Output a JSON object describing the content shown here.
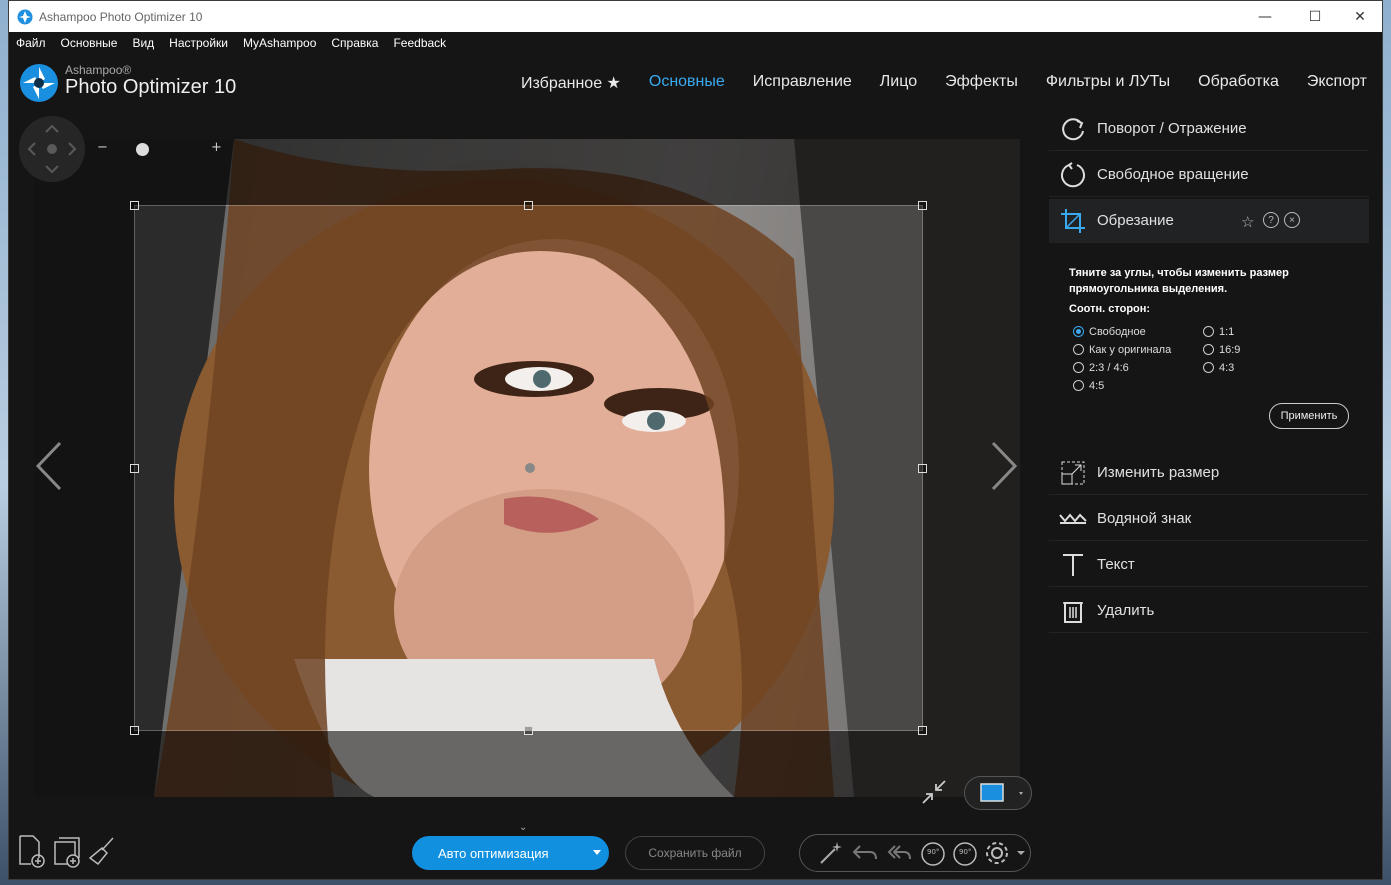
{
  "window": {
    "title": "Ashampoo Photo Optimizer 10",
    "controls": {
      "minimize": "—",
      "maximize": "☐",
      "close": "✕"
    }
  },
  "menu": [
    "Файл",
    "Основные",
    "Вид",
    "Настройки",
    "MyAshampoo",
    "Справка",
    "Feedback"
  ],
  "brand": {
    "small": "Ashampoo®",
    "large": "Photo Optimizer 10"
  },
  "tabs": [
    {
      "label": "Избранное ★",
      "active": false
    },
    {
      "label": "Основные",
      "active": true
    },
    {
      "label": "Исправление",
      "active": false
    },
    {
      "label": "Лицо",
      "active": false
    },
    {
      "label": "Эффекты",
      "active": false
    },
    {
      "label": "Фильтры и ЛУТы",
      "active": false
    },
    {
      "label": "Обработка",
      "active": false
    },
    {
      "label": "Экспорт",
      "active": false
    }
  ],
  "zoom": {
    "minus": "−",
    "plus": "+",
    "level": 0.28
  },
  "right_panel": {
    "items": [
      {
        "label": "Поворот / Отражение",
        "icon": "rotate-flip-icon"
      },
      {
        "label": "Свободное вращение",
        "icon": "free-rotate-icon"
      },
      {
        "label": "Обрезание",
        "icon": "crop-icon",
        "selected": true
      },
      {
        "label": "Изменить размер",
        "icon": "resize-icon"
      },
      {
        "label": "Водяной знак",
        "icon": "watermark-icon"
      },
      {
        "label": "Текст",
        "icon": "text-icon"
      },
      {
        "label": "Удалить",
        "icon": "trash-icon"
      }
    ],
    "crop": {
      "hint": "Тяните за углы, чтобы изменить размер прямоугольника выделения.",
      "ratio_label": "Соотн. сторон:",
      "options": [
        {
          "label": "Свободное",
          "checked": true
        },
        {
          "label": "Как у оригинала",
          "checked": false
        },
        {
          "label": "2:3 / 4:6",
          "checked": false
        },
        {
          "label": "4:5",
          "checked": false
        },
        {
          "label": "1:1",
          "checked": false
        },
        {
          "label": "16:9",
          "checked": false
        },
        {
          "label": "4:3",
          "checked": false
        }
      ],
      "apply": "Применить"
    }
  },
  "bottom": {
    "auto_optimize": "Авто оптимизация",
    "save_file": "Сохранить файл",
    "rotate_left_badge": "90°",
    "rotate_right_badge": "90°"
  },
  "colors": {
    "accent": "#3aaaf0",
    "button_blue": "#1290e0",
    "background": "#151515"
  }
}
